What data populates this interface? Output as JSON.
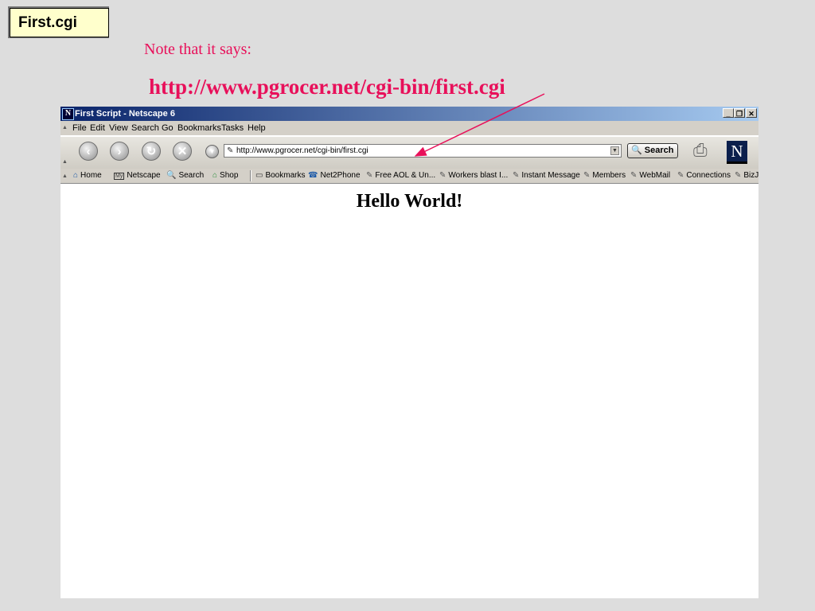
{
  "slide": {
    "title": "First.cgi",
    "note": "Note that it says:",
    "url_callout": "http://www.pgrocer.net/cgi-bin/first.cgi",
    "accent_color": "#e8105a"
  },
  "window": {
    "app_icon": "N",
    "title": "First Script - Netscape 6",
    "controls": {
      "minimize_icon": "minimize-icon",
      "restore_icon": "restore-icon",
      "close_icon": "close-icon"
    }
  },
  "menubar": {
    "items": [
      "File",
      "Edit",
      "View",
      "Search",
      "Go",
      "Bookmarks",
      "Tasks",
      "Help"
    ]
  },
  "navbar": {
    "buttons": [
      "back-icon",
      "forward-icon",
      "reload-icon",
      "stop-icon"
    ],
    "url_value": "http://www.pgrocer.net/cgi-bin/first.cgi",
    "search_label": "Search",
    "logo_letter": "N"
  },
  "personal_toolbar": {
    "items": [
      {
        "label": "Home",
        "icon": "home-icon"
      },
      {
        "label": "Netscape",
        "icon": "my-netscape-icon"
      },
      {
        "label": "Search",
        "icon": "search-icon"
      },
      {
        "label": "Shop",
        "icon": "shop-icon"
      },
      {
        "label": "Bookmarks",
        "icon": "folder-icon"
      },
      {
        "label": "Net2Phone",
        "icon": "phone-icon"
      },
      {
        "label": "Free AOL & Un...",
        "icon": "bookmark-icon"
      },
      {
        "label": "Workers blast I...",
        "icon": "bookmark-icon"
      },
      {
        "label": "Instant Message",
        "icon": "bookmark-icon"
      },
      {
        "label": "Members",
        "icon": "bookmark-icon"
      },
      {
        "label": "WebMail",
        "icon": "bookmark-icon"
      },
      {
        "label": "Connections",
        "icon": "bookmark-icon"
      },
      {
        "label": "BizJ",
        "icon": "bookmark-icon"
      }
    ]
  },
  "page": {
    "heading": "Hello World!"
  }
}
